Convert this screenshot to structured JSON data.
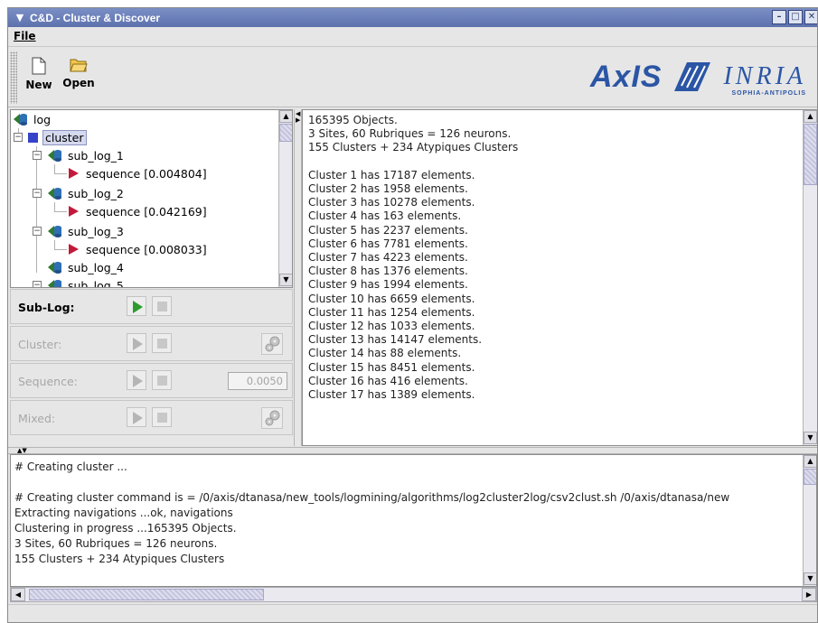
{
  "window": {
    "title": "C&D - Cluster & Discover",
    "minimize_symbol": "–",
    "maximize_symbol": "□",
    "close_symbol": "✕"
  },
  "menu": {
    "file": "File"
  },
  "toolbar": {
    "new_label": "New",
    "open_label": "Open"
  },
  "logo": {
    "axis": "AxIS",
    "inria": "INRIA",
    "inria_sub": "SOPHIA-ANTIPOLIS"
  },
  "tree": {
    "root": "log",
    "cluster": "cluster",
    "items": [
      {
        "label": "sub_log_1",
        "sequence": "sequence [0.004804]"
      },
      {
        "label": "sub_log_2",
        "sequence": "sequence [0.042169]"
      },
      {
        "label": "sub_log_3",
        "sequence": "sequence [0.008033]"
      },
      {
        "label": "sub_log_4"
      },
      {
        "label": "sub_log_5"
      }
    ]
  },
  "controls": {
    "sublog": "Sub-Log:",
    "cluster": "Cluster:",
    "sequence": "Sequence:",
    "sequence_value": "0.0050",
    "mixed": "Mixed:"
  },
  "output_lines": [
    "165395 Objects.",
    "3 Sites, 60 Rubriques = 126 neurons.",
    "155 Clusters + 234 Atypiques Clusters",
    "",
    "Cluster 1 has 17187 elements.",
    "Cluster 2 has 1958 elements.",
    "Cluster 3 has 10278 elements.",
    "Cluster 4 has 163 elements.",
    "Cluster 5 has 2237 elements.",
    "Cluster 6 has 7781 elements.",
    "Cluster 7 has 4223 elements.",
    "Cluster 8 has 1376 elements.",
    "Cluster 9 has 1994 elements.",
    "Cluster 10 has 6659 elements.",
    "Cluster 11 has 1254 elements.",
    "Cluster 12 has 1033 elements.",
    "Cluster 13 has 14147 elements.",
    "Cluster 14 has 88 elements.",
    "Cluster 15 has 8451 elements.",
    "Cluster 16 has 416 elements.",
    "Cluster 17 has 1389 elements."
  ],
  "console_lines": [
    "# Creating cluster ...",
    "",
    "# Creating cluster command is = /0/axis/dtanasa/new_tools/logmining/algorithms/log2cluster2log/csv2clust.sh /0/axis/dtanasa/new",
    "Extracting navigations ...ok, navigations",
    "Clustering in progress ...165395 Objects.",
    "3 Sites, 60 Rubriques = 126 neurons.",
    "155 Clusters + 234 Atypiques Clusters"
  ],
  "colors": {
    "titlebar": "#5d72ad",
    "accent": "#2b55a5",
    "arrow": "#c21a3a",
    "play": "#2d9b2d"
  }
}
